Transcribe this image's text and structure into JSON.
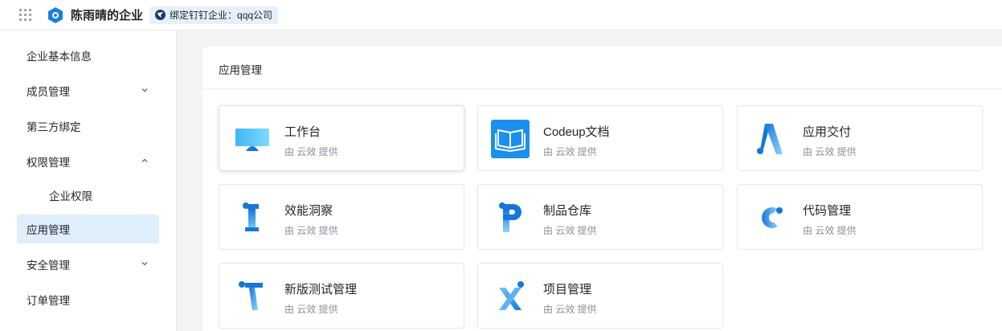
{
  "header": {
    "org_name": "陈雨晴的企业",
    "bind_label": "绑定钉钉企业：qqq公司",
    "icons": [
      "apps-grid-icon",
      "yunxiao-logo-icon",
      "dingtalk-icon"
    ]
  },
  "sidebar": {
    "items": [
      {
        "label": "企业基本信息"
      },
      {
        "label": "成员管理"
      },
      {
        "label": "第三方绑定"
      },
      {
        "label": "权限管理"
      },
      {
        "label": "企业权限"
      },
      {
        "label": "应用管理"
      },
      {
        "label": "安全管理"
      },
      {
        "label": "订单管理"
      }
    ],
    "active_item": "应用管理"
  },
  "main": {
    "title": "应用管理",
    "apps": [
      {
        "name": "工作台",
        "provider": "由 云效 提供",
        "icon": "workbench-monitor-icon"
      },
      {
        "name": "Codeup文档",
        "provider": "由 云效 提供",
        "icon": "book-icon"
      },
      {
        "name": "应用交付",
        "provider": "由 云效 提供",
        "icon": "letter-a-icon"
      },
      {
        "name": "效能洞察",
        "provider": "由 云效 提供",
        "icon": "letter-i-icon"
      },
      {
        "name": "制品仓库",
        "provider": "由 云效 提供",
        "icon": "letter-p-icon"
      },
      {
        "name": "代码管理",
        "provider": "由 云效 提供",
        "icon": "letter-c-icon"
      },
      {
        "name": "新版测试管理",
        "provider": "由 云效 提供",
        "icon": "letter-t-icon"
      },
      {
        "name": "项目管理",
        "provider": "由 云效 提供",
        "icon": "letter-x-icon"
      }
    ]
  },
  "colors": {
    "accent": "#1b7fe0",
    "active_bg": "#dfeefb",
    "icon_blue": "#1677d9",
    "icon_light_blue": "#5fc3f5"
  }
}
